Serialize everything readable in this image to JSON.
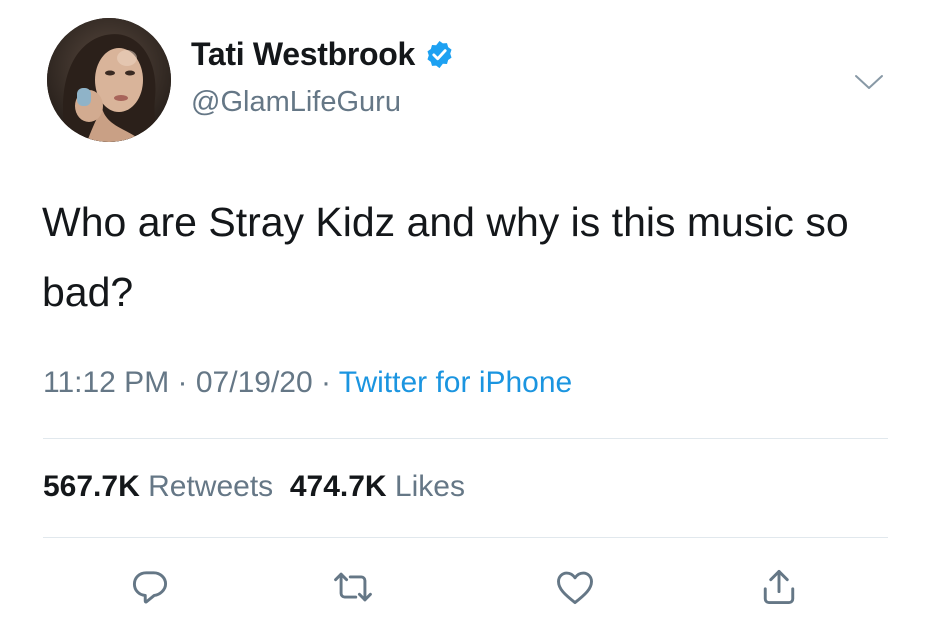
{
  "tweet": {
    "author": {
      "display_name": "Tati Westbrook",
      "handle": "@GlamLifeGuru",
      "verified": true,
      "avatar_icon": "profile-photo"
    },
    "text": "Who are Stray Kidz and why is this music so bad?",
    "time": "11:12 PM",
    "separator": "·",
    "date": "07/19/20",
    "source": "Twitter for iPhone",
    "stats": {
      "retweets_count": "567.7K",
      "retweets_label": "Retweets",
      "likes_count": "474.7K",
      "likes_label": "Likes"
    },
    "actions": {
      "reply_icon": "reply-icon",
      "retweet_icon": "retweet-icon",
      "like_icon": "heart-icon",
      "share_icon": "share-icon"
    }
  },
  "colors": {
    "text_primary": "#14171a",
    "text_secondary": "#657786",
    "link": "#1b95e0",
    "verified_badge": "#1da1f2",
    "divider": "#e1e8ed"
  }
}
